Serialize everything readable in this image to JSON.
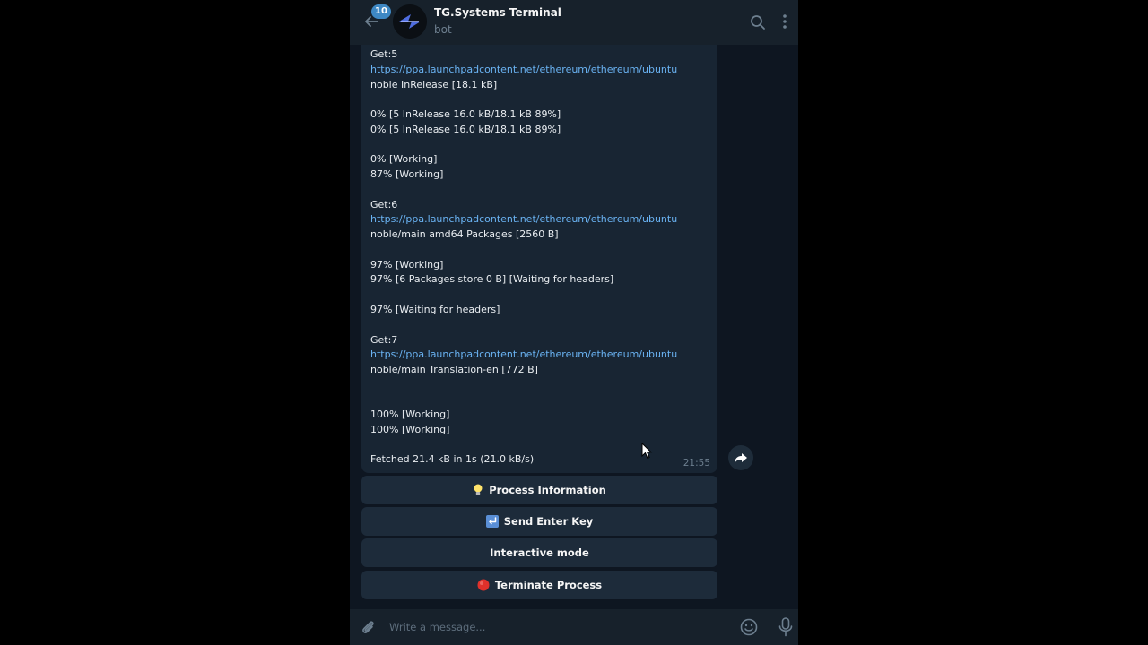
{
  "header": {
    "unread_count": "10",
    "title": "TG.Systems Terminal",
    "subtitle": "bot",
    "icons": [
      "back-arrow-icon",
      "bot-logo-avatar",
      "search-icon",
      "more-vertical-icon"
    ]
  },
  "message": {
    "lines": [
      {
        "text": "Get:5",
        "kind": "text"
      },
      {
        "text": "https://ppa.launchpadcontent.net/ethereum/ethereum/ubuntu",
        "kind": "link"
      },
      {
        "text": "noble InRelease [18.1 kB]",
        "kind": "text"
      },
      {
        "text": "0% [5 InRelease 16.0 kB/18.1 kB 89%]",
        "kind": "text"
      },
      {
        "text": "0% [5 InRelease 16.0 kB/18.1 kB 89%]",
        "kind": "text"
      },
      {
        "text": "0% [Working]",
        "kind": "text"
      },
      {
        "text": "87% [Working]",
        "kind": "text"
      },
      {
        "text": "Get:6",
        "kind": "text"
      },
      {
        "text": "https://ppa.launchpadcontent.net/ethereum/ethereum/ubuntu",
        "kind": "link"
      },
      {
        "text": "noble/main amd64 Packages [2560 B]",
        "kind": "text"
      },
      {
        "text": "97% [Working]",
        "kind": "text"
      },
      {
        "text": "97% [6 Packages store 0 B] [Waiting for headers]",
        "kind": "text"
      },
      {
        "text": "97% [Waiting for headers]",
        "kind": "text"
      },
      {
        "text": "Get:7",
        "kind": "text"
      },
      {
        "text": "https://ppa.launchpadcontent.net/ethereum/ethereum/ubuntu",
        "kind": "link"
      },
      {
        "text": "noble/main Translation-en [772 B]",
        "kind": "text"
      },
      {
        "text": "100% [Working]",
        "kind": "text"
      },
      {
        "text": "100% [Working]",
        "kind": "text"
      },
      {
        "text": "Fetched 21.4 kB in 1s (21.0 kB/s)",
        "kind": "text"
      }
    ],
    "time": "21:55"
  },
  "keyboard": {
    "buttons": [
      {
        "label": "Process Information",
        "icon": "lightbulb-icon"
      },
      {
        "label": "Send Enter Key",
        "icon": "return-arrow-icon"
      },
      {
        "label": "Interactive mode",
        "icon": ""
      },
      {
        "label": "Terminate Process",
        "icon": "red-circle-icon"
      }
    ]
  },
  "composer": {
    "placeholder": "Write a message...",
    "icons": [
      "attach-icon",
      "emoji-icon",
      "microphone-icon"
    ]
  },
  "colors": {
    "background": "#0e1621",
    "header": "#17212b",
    "bubble": "#182533",
    "link": "#6ab3f3",
    "badge": "#3e88c4",
    "keyboard_button": "#1d2b3a"
  }
}
